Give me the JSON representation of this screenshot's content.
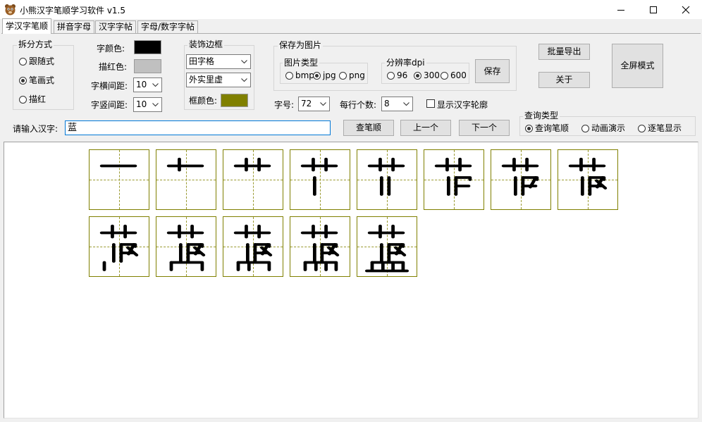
{
  "window": {
    "title": "小熊汉字笔顺学习软件 v1.5"
  },
  "tabs": [
    {
      "label": "学汉字笔顺",
      "active": true
    },
    {
      "label": "拼音字母",
      "active": false
    },
    {
      "label": "汉字字帖",
      "active": false
    },
    {
      "label": "字母/数字字帖",
      "active": false
    }
  ],
  "split_mode": {
    "title": "拆分方式",
    "options": [
      "跟随式",
      "笔画式",
      "描红"
    ],
    "selected": "笔画式"
  },
  "colors": {
    "char_color_label": "字颜色:",
    "char_color": "#000000",
    "trace_color_label": "描红色:",
    "trace_color": "#c0c0c0",
    "hspacing_label": "字横间距:",
    "hspacing_value": "10",
    "vspacing_label": "字竖间距:",
    "vspacing_value": "10"
  },
  "border_group": {
    "title": "装饰边框",
    "grid_style": "田字格",
    "line_style": "外实里虚",
    "frame_color_label": "框颜色:",
    "frame_color": "#808000"
  },
  "save_image": {
    "title": "保存为图片",
    "type_title": "图片类型",
    "types": [
      "bmp",
      "jpg",
      "png"
    ],
    "type_selected": "jpg",
    "dpi_title": "分辨率dpi",
    "dpis": [
      "96",
      "300",
      "600"
    ],
    "dpi_selected": "300",
    "save_button": "保存"
  },
  "size_row": {
    "size_label": "字号:",
    "size_value": "72",
    "per_row_label": "每行个数:",
    "per_row_value": "8",
    "outline_label": "显示汉字轮廓",
    "outline_checked": false
  },
  "buttons": {
    "batch_export": "批量导出",
    "about": "关于",
    "fullscreen": "全屏模式",
    "lookup": "查笔顺",
    "prev": "上一个",
    "next": "下一个"
  },
  "input": {
    "label": "请输入汉字:",
    "value": "蓝"
  },
  "query_type": {
    "title": "查询类型",
    "options": [
      "查询笔顺",
      "动画演示",
      "逐笔显示"
    ],
    "selected": "查询笔顺"
  },
  "stroke_order": {
    "character": "蓝",
    "final_character": "蓝",
    "stroke_count": 13,
    "grid_color": "#808000"
  }
}
